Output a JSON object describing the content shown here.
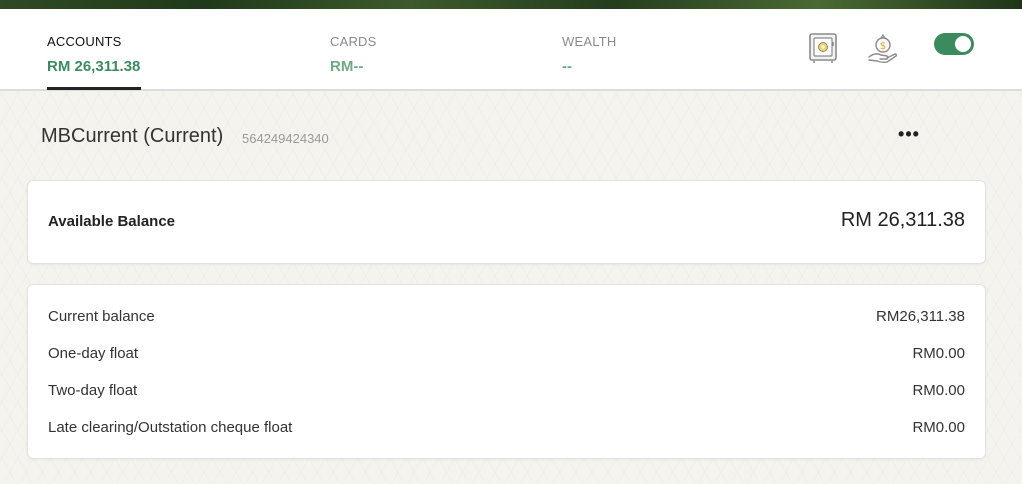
{
  "tabs": [
    {
      "label": "ACCOUNTS",
      "value": "RM 26,311.38"
    },
    {
      "label": "CARDS",
      "value": "RM--"
    },
    {
      "label": "WEALTH",
      "value": "--"
    }
  ],
  "toolbar": {
    "icons": [
      "safe-icon",
      "money-hand-icon"
    ],
    "toggle_on": true
  },
  "colors": {
    "accent_green": "#3c8b5f",
    "muted_green": "#6fa886"
  },
  "account": {
    "name": "MBCurrent (Current)",
    "number": "564249424340",
    "more_label": "•••"
  },
  "available": {
    "label": "Available Balance",
    "value": "RM 26,311.38"
  },
  "details": [
    {
      "label": "Current balance",
      "value": "RM26,311.38"
    },
    {
      "label": "One-day float",
      "value": "RM0.00"
    },
    {
      "label": "Two-day float",
      "value": "RM0.00"
    },
    {
      "label": "Late clearing/Outstation cheque float",
      "value": "RM0.00"
    }
  ]
}
